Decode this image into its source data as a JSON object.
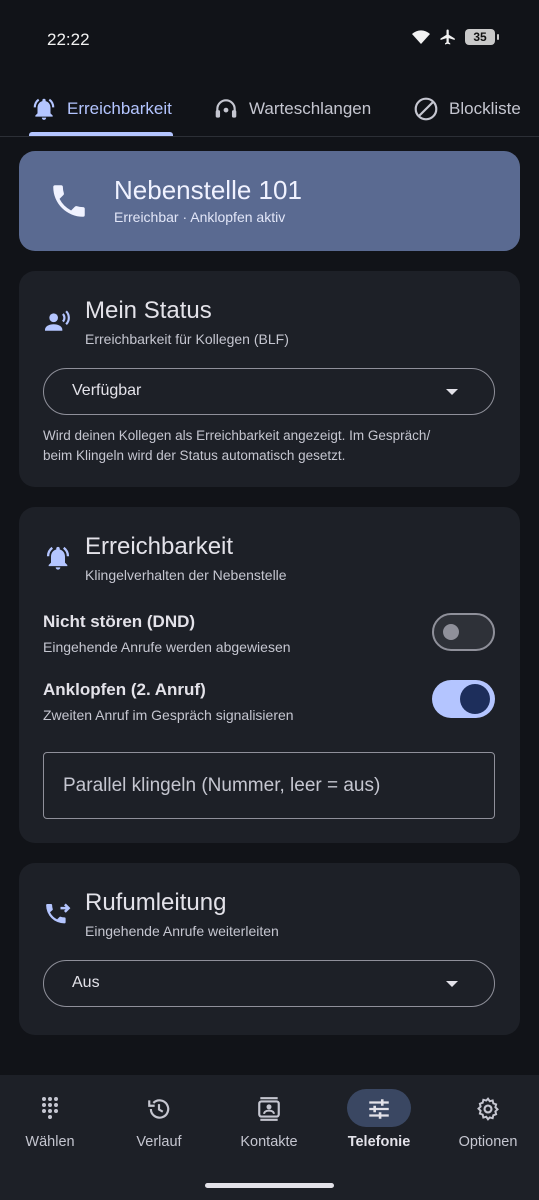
{
  "status_bar": {
    "time": "22:22",
    "battery": "35",
    "icons": [
      "wifi-icon",
      "airplane-icon",
      "battery-icon"
    ]
  },
  "tabs": [
    {
      "label": "Erreichbarkeit",
      "icon": "bell-icon",
      "active": true
    },
    {
      "label": "Warteschlangen",
      "icon": "headset-icon",
      "active": false
    },
    {
      "label": "Blockliste",
      "icon": "block-icon",
      "active": false
    }
  ],
  "extension": {
    "title": "Nebenstelle 101",
    "subtitle": "Erreichbar · Anklopfen aktiv",
    "icon": "phone-icon"
  },
  "my_status": {
    "title": "Mein Status",
    "subtitle": "Erreichbarkeit für Kollegen (BLF)",
    "selected": "Verfügbar",
    "help_line1": "Wird deinen Kollegen als Erreichbarkeit angezeigt. Im Gespräch/",
    "help_line2": "beim Klingeln wird der Status automatisch gesetzt."
  },
  "reachability": {
    "title": "Erreichbarkeit",
    "subtitle": "Klingelverhalten der Nebenstelle",
    "dnd": {
      "title": "Nicht stören (DND)",
      "subtitle": "Eingehende Anrufe werden abgewiesen",
      "enabled": false
    },
    "call_waiting": {
      "title": "Anklopfen (2. Anruf)",
      "subtitle": "Zweiten Anruf im Gespräch signalisieren",
      "enabled": true
    },
    "parallel_ring_placeholder": "Parallel klingeln (Nummer, leer = aus)",
    "parallel_ring_value": ""
  },
  "forwarding": {
    "title": "Rufumleitung",
    "subtitle": "Eingehende Anrufe weiterleiten",
    "selected": "Aus"
  },
  "bottom_nav": [
    {
      "label": "Wählen",
      "icon": "dialpad-icon",
      "active": false
    },
    {
      "label": "Verlauf",
      "icon": "history-icon",
      "active": false
    },
    {
      "label": "Kontakte",
      "icon": "contacts-icon",
      "active": false
    },
    {
      "label": "Telefonie",
      "icon": "tune-icon",
      "active": true
    },
    {
      "label": "Optionen",
      "icon": "gear-icon",
      "active": false
    }
  ],
  "colors": {
    "background": "#111318",
    "card": "#1d2027",
    "accent": "#b4c5ff",
    "extension_card": "#5a6a91"
  }
}
